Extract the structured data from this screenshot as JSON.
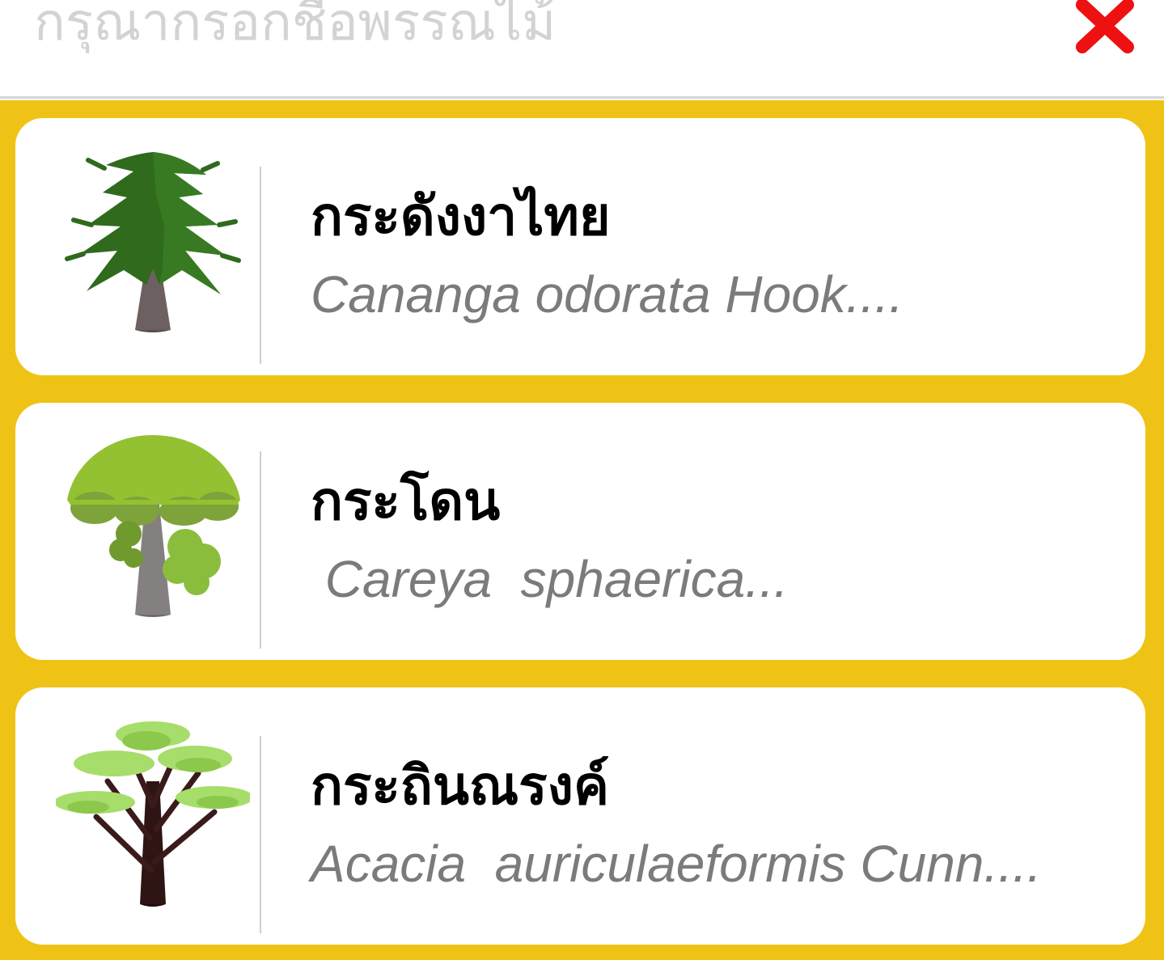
{
  "search": {
    "placeholder": "กรุณากรอกชื่อพรรณไม้",
    "value": "",
    "close_icon": "close-x-icon",
    "close_color": "#ee1111"
  },
  "colors": {
    "background_accent": "#efc315",
    "card_background": "#ffffff",
    "title_text": "#000000",
    "subtitle_text": "#7b7b7b"
  },
  "results": [
    {
      "thai_name": "กระดังงาไทย",
      "scientific_name": "Cananga odorata Hook....",
      "icon": "conifer-tree-icon"
    },
    {
      "thai_name": "กระโดน",
      "scientific_name": " Careya  sphaerica...",
      "icon": "round-canopy-tree-icon"
    },
    {
      "thai_name": "กระถินณรงค์",
      "scientific_name": "Acacia  auriculaeformis Cunn....",
      "icon": "layered-canopy-tree-icon"
    }
  ]
}
